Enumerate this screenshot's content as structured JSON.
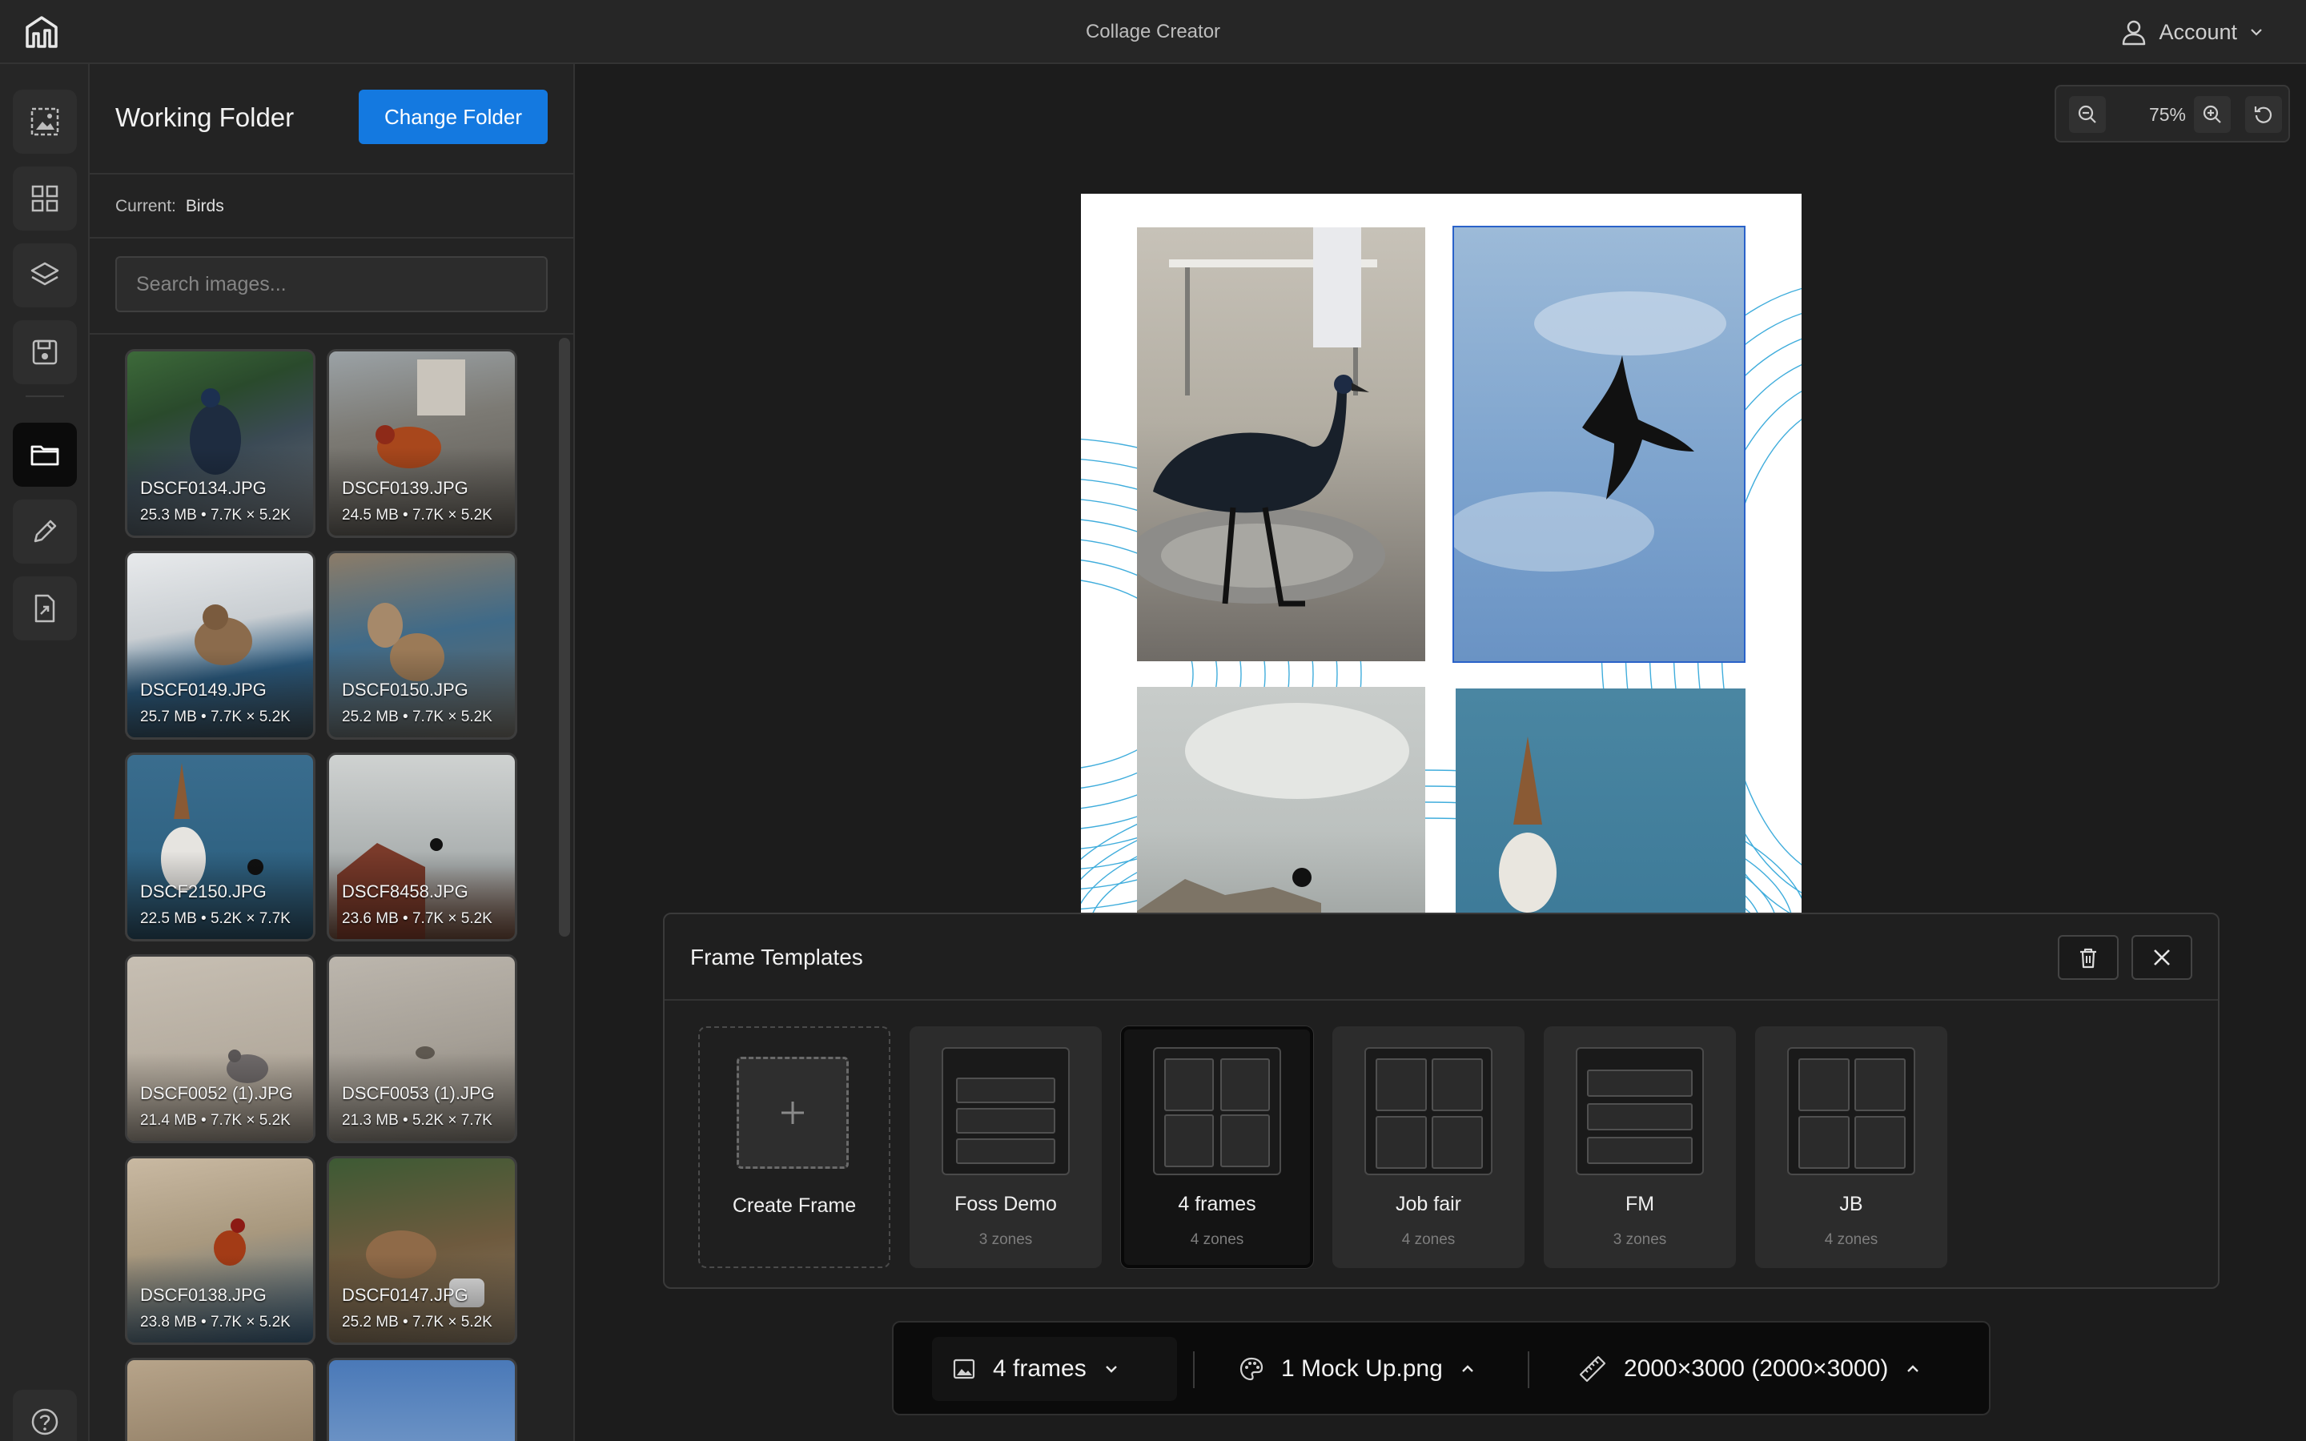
{
  "app": {
    "title": "Collage Creator",
    "account_label": "Account"
  },
  "folder": {
    "title": "Working Folder",
    "change_button": "Change Folder",
    "current_label": "Current:",
    "current_value": "Birds",
    "search_placeholder": "Search images..."
  },
  "images": [
    {
      "name": "DSCF0134.JPG",
      "size": "25.3 MB",
      "dims": "7.7K × 5.2K"
    },
    {
      "name": "DSCF0139.JPG",
      "size": "24.5 MB",
      "dims": "7.7K × 5.2K"
    },
    {
      "name": "DSCF0149.JPG",
      "size": "25.7 MB",
      "dims": "7.7K × 5.2K"
    },
    {
      "name": "DSCF0150.JPG",
      "size": "25.2 MB",
      "dims": "7.7K × 5.2K"
    },
    {
      "name": "DSCF2150.JPG",
      "size": "22.5 MB",
      "dims": "5.2K × 7.7K"
    },
    {
      "name": "DSCF8458.JPG",
      "size": "23.6 MB",
      "dims": "7.7K × 5.2K"
    },
    {
      "name": "DSCF0052 (1).JPG",
      "size": "21.4 MB",
      "dims": "7.7K × 5.2K"
    },
    {
      "name": "DSCF0053 (1).JPG",
      "size": "21.3 MB",
      "dims": "5.2K × 7.7K"
    },
    {
      "name": "DSCF0138.JPG",
      "size": "23.8 MB",
      "dims": "7.7K × 5.2K"
    },
    {
      "name": "DSCF0147.JPG",
      "size": "25.2 MB",
      "dims": "7.7K × 5.2K"
    }
  ],
  "meta_separator": "•",
  "zoom": {
    "level": "75%"
  },
  "templates": {
    "title": "Frame Templates",
    "items": [
      {
        "name": "Create Frame",
        "zones": ""
      },
      {
        "name": "Foss Demo",
        "zones": "3 zones"
      },
      {
        "name": "4 frames",
        "zones": "4 zones",
        "selected": true
      },
      {
        "name": "Job fair",
        "zones": "4 zones"
      },
      {
        "name": "FM",
        "zones": "3 zones"
      },
      {
        "name": "JB",
        "zones": "4 zones"
      }
    ]
  },
  "toolbar": {
    "frames_label": "4 frames",
    "background_label": "1 Mock Up.png",
    "size_label": "2000×3000 (2000×3000)"
  },
  "colors": {
    "accent": "#1479e0",
    "line_pattern": "#1f9fd6",
    "frame_border": "#2a62c9"
  },
  "icons": {
    "rail": [
      "image-select-icon",
      "grid-icon",
      "layers-icon",
      "save-icon",
      "folder-icon",
      "pencil-icon",
      "export-icon",
      "help-icon"
    ]
  }
}
